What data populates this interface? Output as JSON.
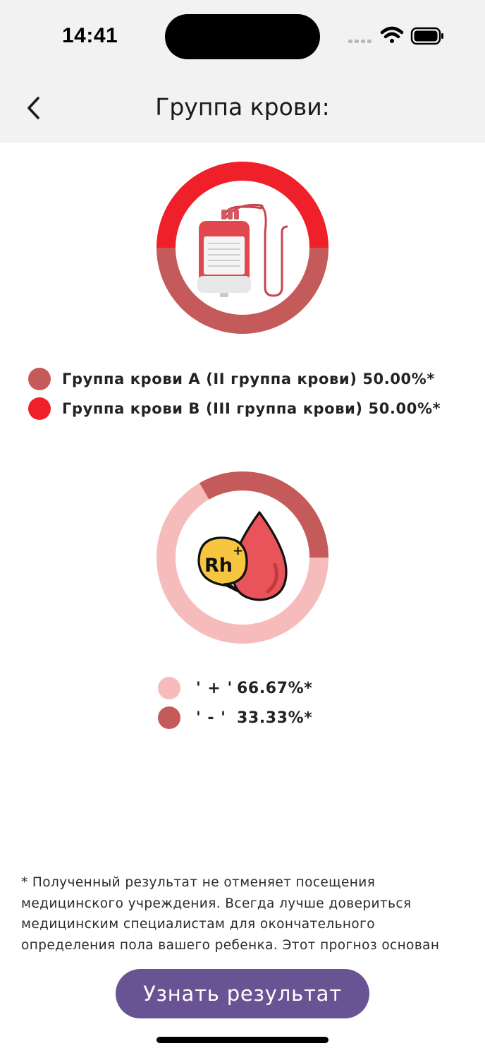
{
  "status_bar": {
    "time": "14:41"
  },
  "nav": {
    "title": "Группа крови:"
  },
  "blood_group_chart": {
    "slices": [
      {
        "label": "Группа крови A (II группа крови) 50.00%*",
        "value": 50.0,
        "color": "#c55a5a"
      },
      {
        "label": "Группа крови B (III группа крови) 50.00%*",
        "value": 50.0,
        "color": "#f0202a"
      }
    ]
  },
  "rh_chart": {
    "slices": [
      {
        "sign": "' + '",
        "percent": "66.67%*",
        "value": 66.67,
        "color": "#f6bcbc"
      },
      {
        "sign": "' - '",
        "percent": "33.33%*",
        "value": 33.33,
        "color": "#c55a5a"
      }
    ],
    "icon_text": "Rh"
  },
  "disclaimer": "* Полученный результат не отменяет посещения медицинского учреждения. Всегда лучше довериться медицинским специалистам для окончательного определения пола вашего ребенка. Этот прогноз основан",
  "cta": {
    "label": "Узнать результат"
  },
  "colors": {
    "accent": "#6a5392",
    "topbar_bg": "#f2f2f2"
  },
  "chart_data": [
    {
      "type": "pie",
      "categories": [
        "Группа крови A (II группа крови)",
        "Группа крови B (III группа крови)"
      ],
      "values": [
        50.0,
        50.0
      ],
      "legend_placement": "bottom"
    },
    {
      "type": "pie",
      "categories": [
        "' + '",
        "' - '"
      ],
      "values": [
        66.67,
        33.33
      ],
      "legend_placement": "bottom"
    }
  ]
}
